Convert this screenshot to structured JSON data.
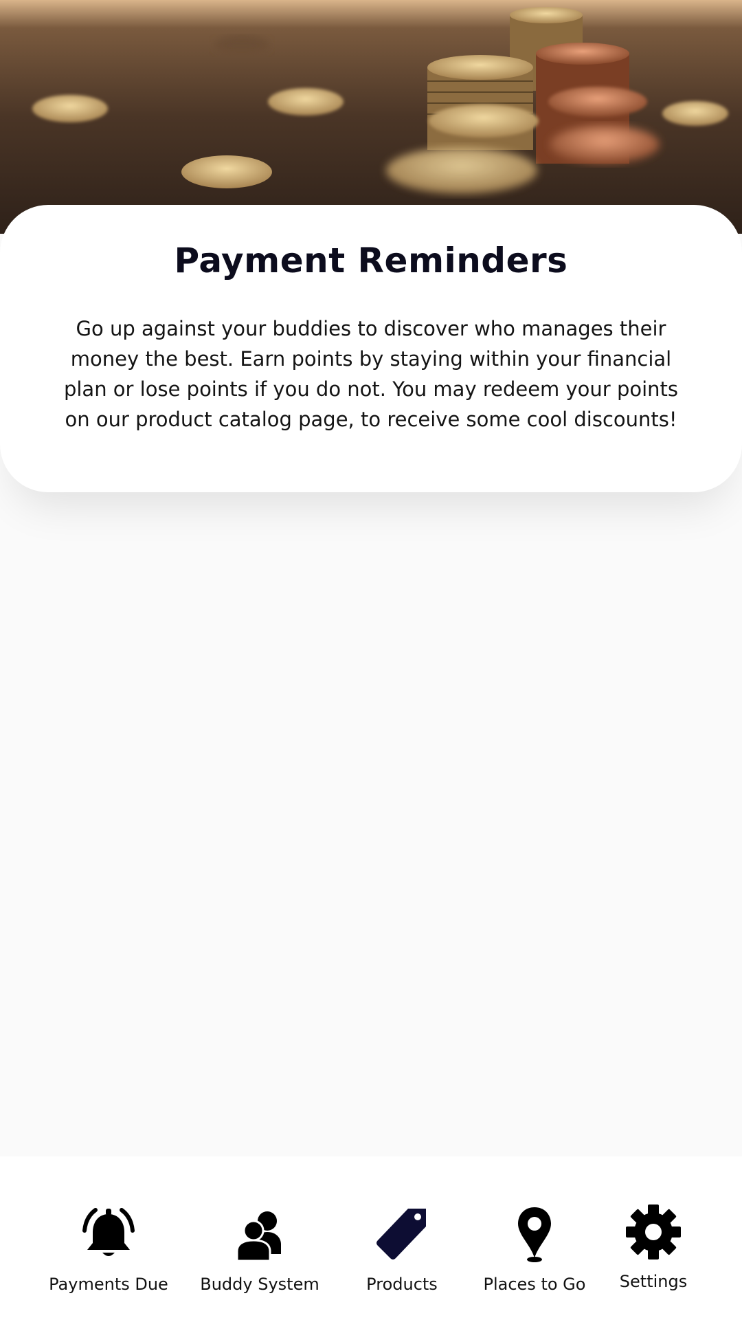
{
  "hero": {
    "image": "stacked-coins-photo"
  },
  "card": {
    "title": "Payment Reminders",
    "body": "Go up against your buddies to discover who manages their money the best. Earn points by staying within your financial plan or lose points if you do not. You may redeem your points on our product catalog page, to receive some cool discounts!"
  },
  "bottom_nav": {
    "items": [
      {
        "label": "Payments Due",
        "icon": "bell-icon"
      },
      {
        "label": "Buddy System",
        "icon": "users-icon"
      },
      {
        "label": "Products",
        "icon": "tag-icon"
      },
      {
        "label": "Places to Go",
        "icon": "map-pin-icon"
      },
      {
        "label": "Settings",
        "icon": "gear-icon"
      }
    ]
  },
  "colors": {
    "background": "#fafafa",
    "card": "#ffffff",
    "title": "#0c0c1d",
    "products_icon": "#0d0d33"
  }
}
